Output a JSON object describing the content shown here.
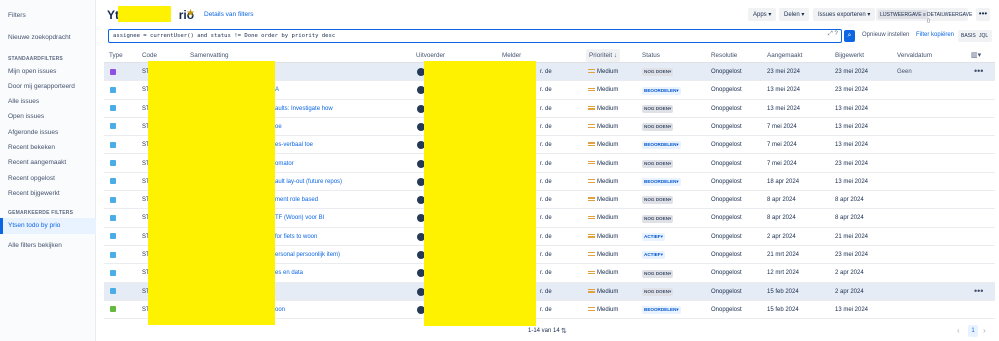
{
  "sidebar": {
    "title": "Filters",
    "new_search": "Nieuwe zoekopdracht",
    "standard_heading": "STANDAARDFILTERS",
    "standard_items": [
      "Mijn open issues",
      "Door mij gerapporteerd",
      "Alle issues",
      "Open issues",
      "Afgeronde issues",
      "Recent bekeken",
      "Recent aangemaakt",
      "Recent opgelost",
      "Recent bijgewerkt"
    ],
    "starred_heading": "GEMARKEERDE FILTERS",
    "starred_item": "Ytsen todo by prio",
    "all_filters": "Alle filters bekijken"
  },
  "header": {
    "title_prefix": "Yts",
    "title_suffix": "rio",
    "star": "★",
    "details_link": "Details van filters",
    "apps": "Apps ▾",
    "share": "Delen ▾",
    "export": "Issues exporteren ▾",
    "list_view": "LIJSTWEERGAVE",
    "detail_view": "DETAILWEERGAVE",
    "more": "•••"
  },
  "query": {
    "text": "assignee = currentUser() and status != Done order by priority desc",
    "reset": "Opnieuw instellen",
    "copy_filter": "Filter kopiëren",
    "basic": "BASIS",
    "jql": "JQL"
  },
  "columns": [
    "Type",
    "Code",
    "Samenvatting",
    "Uitvoerder",
    "Melder",
    "Prioriteit",
    "Status",
    "Resolutie",
    "Aangemaakt",
    "Bijgewerkt",
    "Vervaldatum"
  ],
  "rows": [
    {
      "type": "sub",
      "code": "ST",
      "summary": "",
      "reporter": "r. de",
      "priority": "Medium",
      "status": "NOG DOEN",
      "status_kind": "todo",
      "resolution": "Onopgelost",
      "created": "23 mei 2024",
      "updated": "23 mei 2024",
      "due": "Geen",
      "highlight": true,
      "more": true
    },
    {
      "type": "task",
      "code": "ST",
      "summary": "A",
      "reporter": "r. de",
      "priority": "Medium",
      "status": "BEOORDELEN",
      "status_kind": "blue",
      "resolution": "Onopgelost",
      "created": "13 mei 2024",
      "updated": "23 mei 2024",
      "due": "",
      "highlight": false,
      "more": false
    },
    {
      "type": "task",
      "code": "ST",
      "summary": "aults: Investigate how",
      "reporter": "r. de",
      "priority": "Medium",
      "status": "NOG DOEN",
      "status_kind": "todo",
      "resolution": "Onopgelost",
      "created": "13 mei 2024",
      "updated": "13 mei 2024",
      "due": "",
      "highlight": false,
      "more": false
    },
    {
      "type": "task",
      "code": "ST",
      "summary": "oe",
      "reporter": "r. de",
      "priority": "Medium",
      "status": "NOG DOEN",
      "status_kind": "todo",
      "resolution": "Onopgelost",
      "created": "7 mei 2024",
      "updated": "13 mei 2024",
      "due": "",
      "highlight": false,
      "more": false
    },
    {
      "type": "task",
      "code": "ST",
      "summary": "es-verbaal toe",
      "reporter": "r. de",
      "priority": "Medium",
      "status": "BEOORDELEN",
      "status_kind": "blue",
      "resolution": "Onopgelost",
      "created": "7 mei 2024",
      "updated": "13 mei 2024",
      "due": "",
      "highlight": false,
      "more": false
    },
    {
      "type": "task",
      "code": "ST",
      "summary": "omator",
      "reporter": "r. de",
      "priority": "Medium",
      "status": "NOG DOEN",
      "status_kind": "todo",
      "resolution": "Onopgelost",
      "created": "7 mei 2024",
      "updated": "23 mei 2024",
      "due": "",
      "highlight": false,
      "more": false
    },
    {
      "type": "task",
      "code": "ST",
      "summary": "ault lay-out (future repos)",
      "reporter": "r. de",
      "priority": "Medium",
      "status": "BEOORDELEN",
      "status_kind": "blue",
      "resolution": "Onopgelost",
      "created": "18 apr 2024",
      "updated": "13 mei 2024",
      "due": "",
      "highlight": false,
      "more": false
    },
    {
      "type": "task",
      "code": "ST",
      "summary": "ment role based",
      "reporter": "r. de",
      "priority": "Medium",
      "status": "NOG DOEN",
      "status_kind": "todo",
      "resolution": "Onopgelost",
      "created": "8 apr 2024",
      "updated": "8 apr 2024",
      "due": "",
      "highlight": false,
      "more": false
    },
    {
      "type": "task",
      "code": "ST",
      "summary": "TF (Woon) voor BI",
      "reporter": "r. de",
      "priority": "Medium",
      "status": "NOG DOEN",
      "status_kind": "todo",
      "resolution": "Onopgelost",
      "created": "8 apr 2024",
      "updated": "8 apr 2024",
      "due": "",
      "highlight": false,
      "more": false
    },
    {
      "type": "task",
      "code": "ST",
      "summary": "for fiets to woon",
      "reporter": "r. de",
      "priority": "Medium",
      "status": "ACTIEF",
      "status_kind": "blue",
      "resolution": "Onopgelost",
      "created": "2 apr 2024",
      "updated": "21 mei 2024",
      "due": "",
      "highlight": false,
      "more": false
    },
    {
      "type": "task",
      "code": "ST",
      "summary": "ersonal persoonlijk item)",
      "reporter": "r. de",
      "priority": "Medium",
      "status": "ACTIEF",
      "status_kind": "blue",
      "resolution": "Onopgelost",
      "created": "21 mrt 2024",
      "updated": "23 mei 2024",
      "due": "",
      "highlight": false,
      "more": false
    },
    {
      "type": "task",
      "code": "ST",
      "summary": "es en data",
      "reporter": "r. de",
      "priority": "Medium",
      "status": "NOG DOEN",
      "status_kind": "todo",
      "resolution": "Onopgelost",
      "created": "12 mrt 2024",
      "updated": "2 apr 2024",
      "due": "",
      "highlight": false,
      "more": false
    },
    {
      "type": "task",
      "code": "ST",
      "summary": "",
      "reporter": "r. de",
      "priority": "Medium",
      "status": "NOG DOEN",
      "status_kind": "todo",
      "resolution": "Onopgelost",
      "created": "15 feb 2024",
      "updated": "2 apr 2024",
      "due": "",
      "highlight": true,
      "more": true
    },
    {
      "type": "story",
      "code": "ST",
      "summary": "oon",
      "reporter": "r. de",
      "priority": "Medium",
      "status": "BEOORDELEN",
      "status_kind": "blue",
      "resolution": "Onopgelost",
      "created": "15 feb 2024",
      "updated": "13 mei 2024",
      "due": "",
      "highlight": false,
      "more": false
    }
  ],
  "pager": {
    "range": "1-14 van 14",
    "current_page": "1"
  }
}
